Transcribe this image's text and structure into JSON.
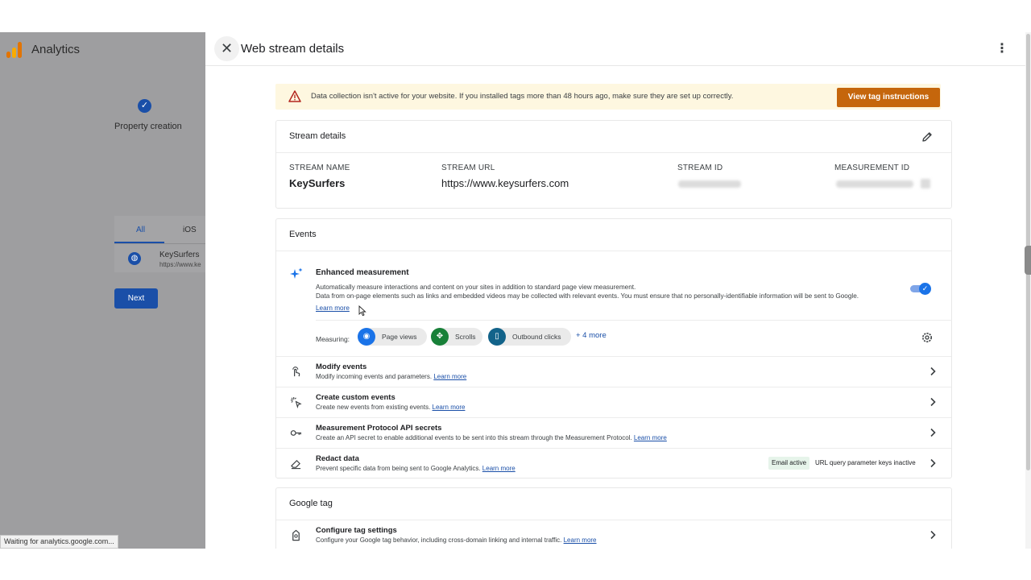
{
  "background_app": {
    "title": "Analytics",
    "step_label": "Property creation",
    "tabs": [
      "All",
      "iOS"
    ],
    "stream_name": "KeySurfers",
    "stream_url": "https://www.ke",
    "next_label": "Next",
    "status_text": "Waiting for analytics.google.com..."
  },
  "drawer": {
    "title": "Web stream details",
    "banner": {
      "text": "Data collection isn't active for your website. If you installed tags more than 48 hours ago, make sure they are set up correctly.",
      "button_label": "View tag instructions"
    },
    "stream_details": {
      "title": "Stream details",
      "stream_name_label": "STREAM NAME",
      "stream_name_value": "KeySurfers",
      "stream_url_label": "STREAM URL",
      "stream_url_value": "https://www.keysurfers.com",
      "stream_id_label": "STREAM ID",
      "measurement_id_label": "MEASUREMENT ID"
    },
    "events": {
      "title": "Events",
      "enhanced": {
        "title": "Enhanced measurement",
        "desc_line1": "Automatically measure interactions and content on your sites in addition to standard page view measurement.",
        "desc_line2": "Data from on-page elements such as links and embedded videos may be collected with relevant events. You must ensure that no personally-identifiable information will be sent to Google.",
        "learn_more": "Learn more",
        "enabled": true,
        "measuring_label": "Measuring:",
        "chips": [
          "Page views",
          "Scrolls",
          "Outbound clicks"
        ],
        "more_label": "+ 4 more"
      },
      "rows": [
        {
          "title": "Modify events",
          "desc": "Modify incoming events and parameters.",
          "link": "Learn more"
        },
        {
          "title": "Create custom events",
          "desc": "Create new events from existing events.",
          "link": "Learn more"
        },
        {
          "title": "Measurement Protocol API secrets",
          "desc": "Create an API secret to enable additional events to be sent into this stream through the Measurement Protocol.",
          "link": "Learn more"
        },
        {
          "title": "Redact data",
          "desc": "Prevent specific data from being sent to Google Analytics.",
          "link": "Learn more",
          "badge_email": "Email active",
          "badge_url": "URL query parameter keys inactive"
        }
      ]
    },
    "google_tag": {
      "title": "Google tag",
      "row": {
        "title": "Configure tag settings",
        "desc": "Configure your Google tag behavior, including cross-domain linking and internal traffic.",
        "link": "Learn more"
      }
    }
  },
  "colors": {
    "accent_blue": "#1a4fa8",
    "warning_button": "#c5660c",
    "banner_bg": "#fef7e0",
    "chip_page_views": "#1a73e8",
    "chip_scrolls": "#188038",
    "chip_outbound": "#12638a"
  }
}
